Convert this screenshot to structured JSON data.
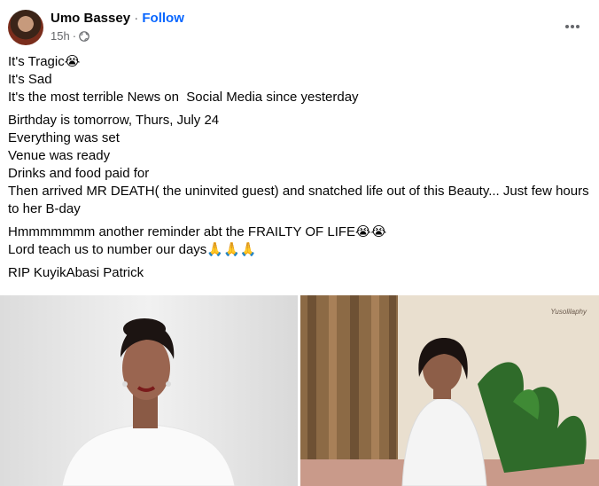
{
  "header": {
    "author": "Umo Bassey",
    "separator": "·",
    "follow_label": "Follow",
    "time": "15h",
    "time_separator": "·",
    "privacy_icon": "globe-icon",
    "more_icon": "more-horizontal-icon"
  },
  "post": {
    "paragraphs": [
      [
        "It's Tragic😭",
        "It's Sad",
        "It's the most terrible News on  Social Media since yesterday"
      ],
      [
        "Birthday is tomorrow, Thurs, July 24",
        "Everything was set",
        "Venue was ready",
        "Drinks and food paid for",
        "Then arrived MR DEATH( the uninvited guest) and snatched life out of this Beauty... Just few hours",
        "to her B-day"
      ],
      [
        "Hmmmmmmm another reminder abt the FRAILTY OF LIFE😭😭",
        "Lord teach us to number our days🙏🙏🙏"
      ],
      [
        "RIP KuyikAbasi Patrick"
      ]
    ]
  },
  "photos": {
    "right_watermark": "Yusolilaphy"
  },
  "colors": {
    "link": "#0866ff",
    "meta": "#65676b",
    "text": "#050505"
  }
}
